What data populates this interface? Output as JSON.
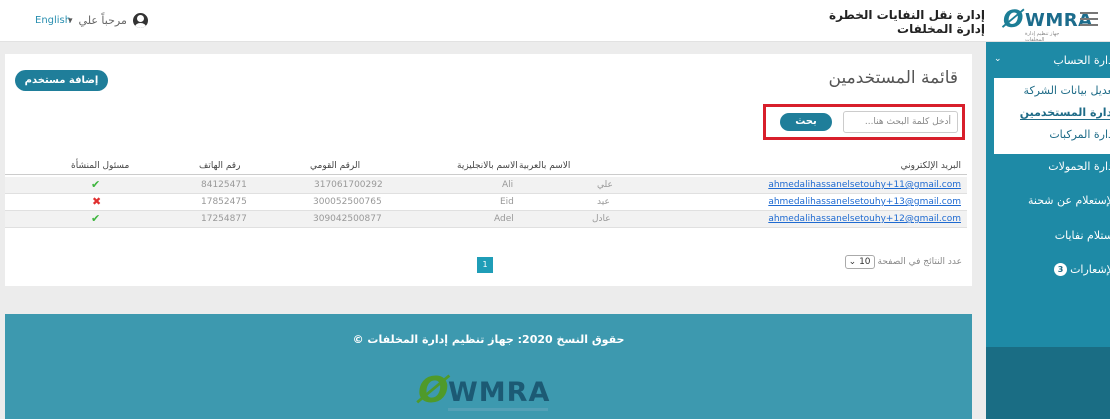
{
  "header": {
    "language_link": "English",
    "greeting": "مرحباً علي",
    "title_line1": "إدارة نقل النفايات الخطرة",
    "title_line2": "إدارة المخلفات",
    "logo_text": "WMRA",
    "logo_subtitle": "جهاز تنظيم إدارة المخلفات"
  },
  "sidebar": {
    "account_section": "إدارة الحساب",
    "submenu": [
      "تعديل بيانات الشركة",
      "إدارة المستخدمين",
      "إدارة المركبات"
    ],
    "items": [
      "إدارة الحمولات",
      "الإستعلام عن شحنة",
      "استلام نفايات",
      "الإشعارات"
    ],
    "notifications_count": "3"
  },
  "main": {
    "page_title": "قائمة المستخدمين",
    "add_user_label": "إضافة مستخدم",
    "search_placeholder": "أدخل كلمة البحث هنا...",
    "search_button": "بحث",
    "columns": [
      "البريد الإلكتروني",
      "الاسم بالعربية",
      "الاسم بالانجليزية",
      "الرقم القومي",
      "رقم الهاتف",
      "مسئول المنشأة"
    ],
    "rows": [
      {
        "email": "ahmedalihassanelsetouhy+11@gmail.com",
        "name_ar": "علي",
        "name_en": "Ali",
        "national_id": "317061700292",
        "phone": "84125471",
        "is_manager": true
      },
      {
        "email": "ahmedalihassanelsetouhy+13@gmail.com",
        "name_ar": "عيد",
        "name_en": "Eid",
        "national_id": "300052500765",
        "phone": "17852475",
        "is_manager": false
      },
      {
        "email": "ahmedalihassanelsetouhy+12@gmail.com",
        "name_ar": "عادل",
        "name_en": "Adel",
        "national_id": "309042500877",
        "phone": "17254877",
        "is_manager": true
      }
    ],
    "current_page": "1",
    "per_page_label": "عدد النتائج في الصفحة",
    "per_page_value": "10"
  },
  "footer": {
    "copyright": "حقوق النسخ 2020: جهاز تنظيم إدارة المخلفات ©",
    "logo_text": "WMRA"
  },
  "colors": {
    "primary": "#1f7e9a",
    "sidebar": "#1e8aa6",
    "footer": "#3d99af",
    "highlight_border": "#d81f2b",
    "check": "#3db53d",
    "cross": "#e03030"
  }
}
